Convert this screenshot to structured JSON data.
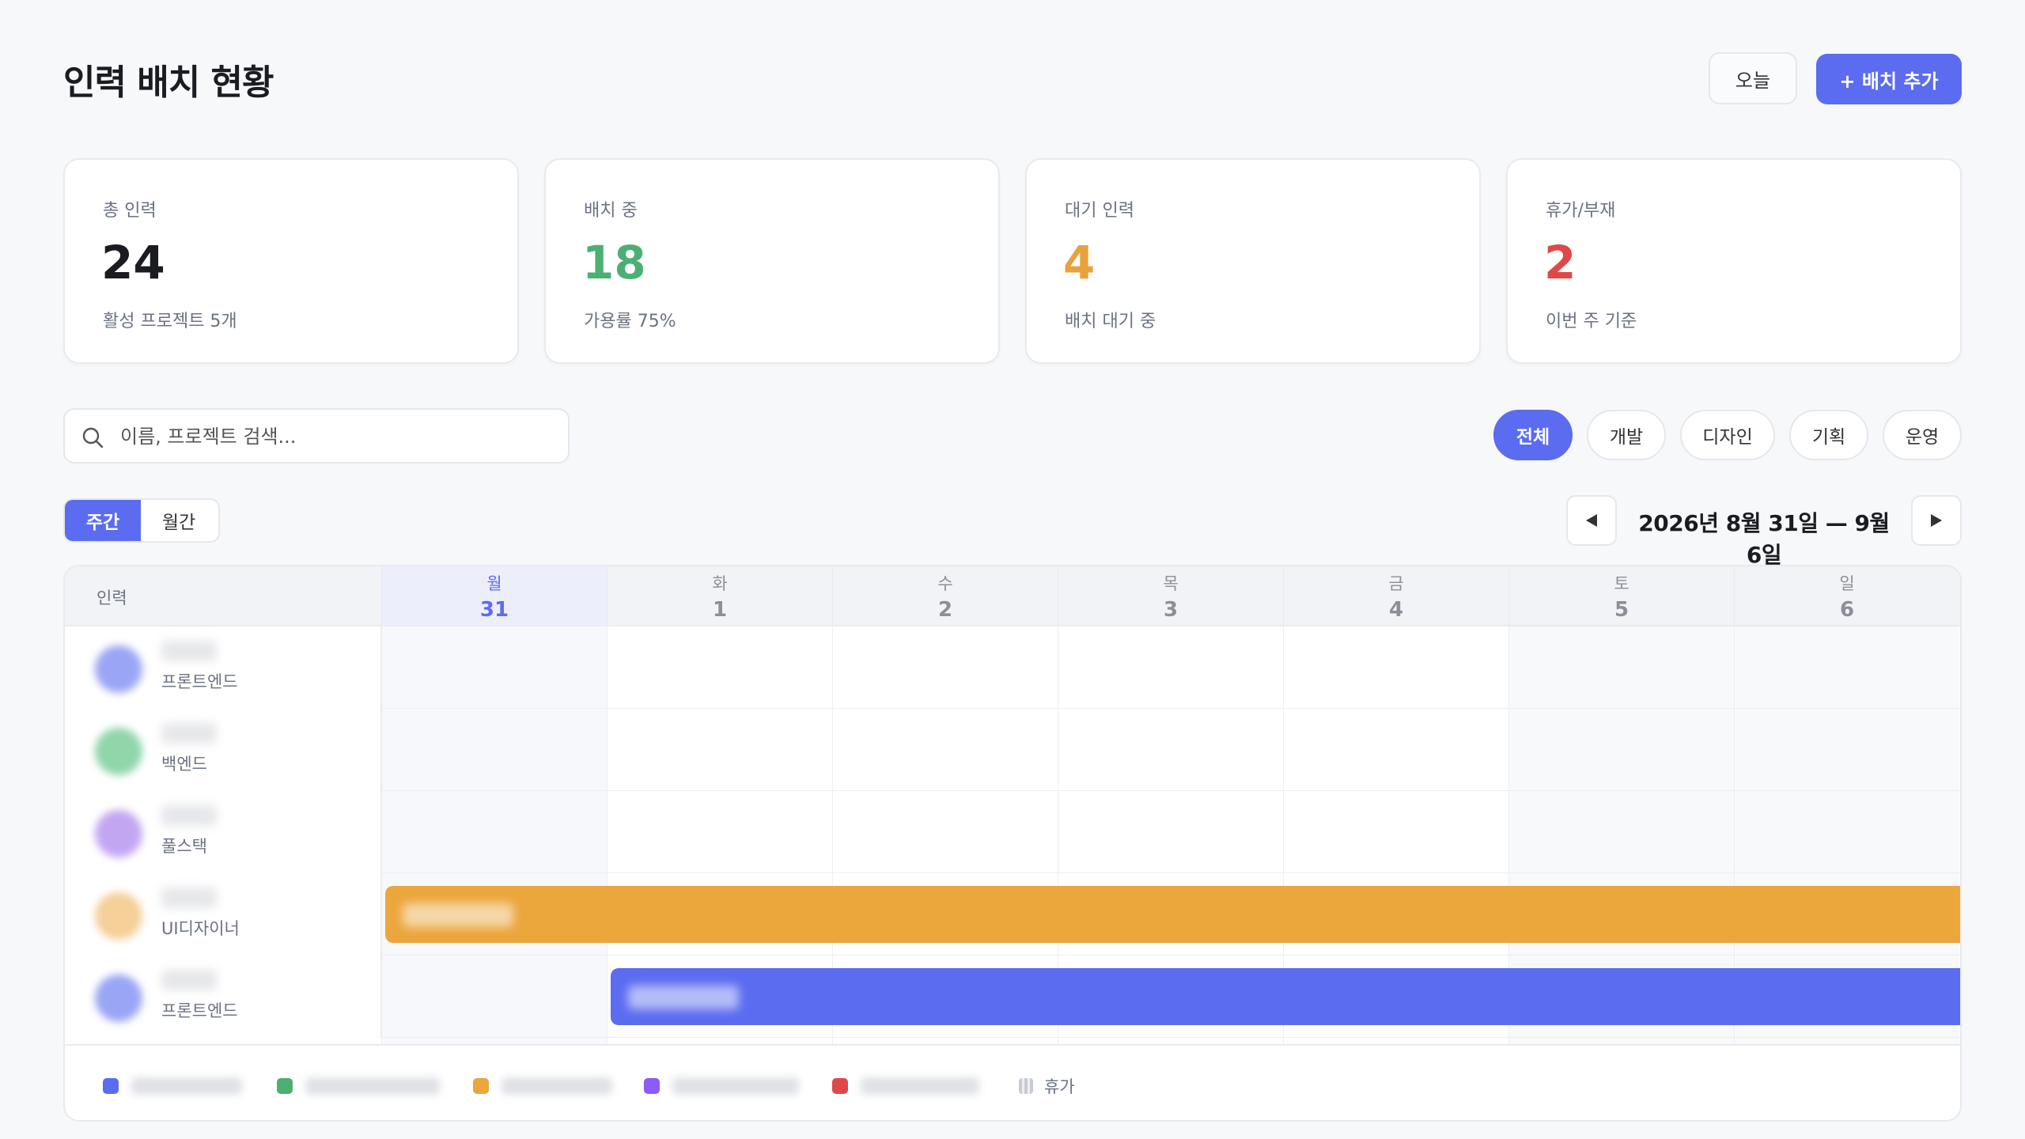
{
  "header": {
    "title": "인력 배치 현황",
    "today_label": "오늘",
    "add_label": "+ 배치 추가"
  },
  "stats": [
    {
      "label": "총 인력",
      "value": "24",
      "sub": "활성 프로젝트 5개",
      "color": "#1a1c21"
    },
    {
      "label": "배치 중",
      "value": "18",
      "sub": "가용률 75%",
      "color": "#4caf74"
    },
    {
      "label": "대기 인력",
      "value": "4",
      "sub": "배치 대기 중",
      "color": "#e9a23b"
    },
    {
      "label": "휴가/부재",
      "value": "2",
      "sub": "이번 주 기준",
      "color": "#e04848"
    }
  ],
  "search": {
    "placeholder": "이름, 프로젝트 검색..."
  },
  "filters": [
    "전체",
    "개발",
    "디자인",
    "기획",
    "운영"
  ],
  "active_filter": "전체",
  "view": {
    "weekly": "주간",
    "monthly": "월간",
    "active": "주간"
  },
  "date_range": "2026년 8월 31일 — 9월 6일",
  "schedule": {
    "person_header": "인력",
    "days": [
      {
        "name": "월",
        "num": "31",
        "today": true
      },
      {
        "name": "화",
        "num": "1"
      },
      {
        "name": "수",
        "num": "2"
      },
      {
        "name": "목",
        "num": "3"
      },
      {
        "name": "금",
        "num": "4"
      },
      {
        "name": "토",
        "num": "5",
        "weekend": true
      },
      {
        "name": "일",
        "num": "6",
        "weekend": true
      }
    ],
    "rows": [
      {
        "role": "프론트엔드",
        "avatar_color": "#9aa6f5"
      },
      {
        "role": "백엔드",
        "avatar_color": "#8fd6ab"
      },
      {
        "role": "풀스택",
        "avatar_color": "#c3a6f2"
      },
      {
        "role": "UI디자이너",
        "avatar_color": "#f6cf99"
      },
      {
        "role": "프론트엔드",
        "avatar_color": "#9aa6f5"
      }
    ],
    "bars": [
      {
        "row": 3,
        "start_day": 0,
        "color": "#eba63c"
      },
      {
        "row": 4,
        "start_day": 1,
        "color": "#5b6cf0"
      }
    ]
  },
  "legend": {
    "colors": [
      "#5b6cf0",
      "#4caf74",
      "#eba63c",
      "#8b5cf6",
      "#e04848"
    ],
    "vacation_label": "휴가"
  }
}
